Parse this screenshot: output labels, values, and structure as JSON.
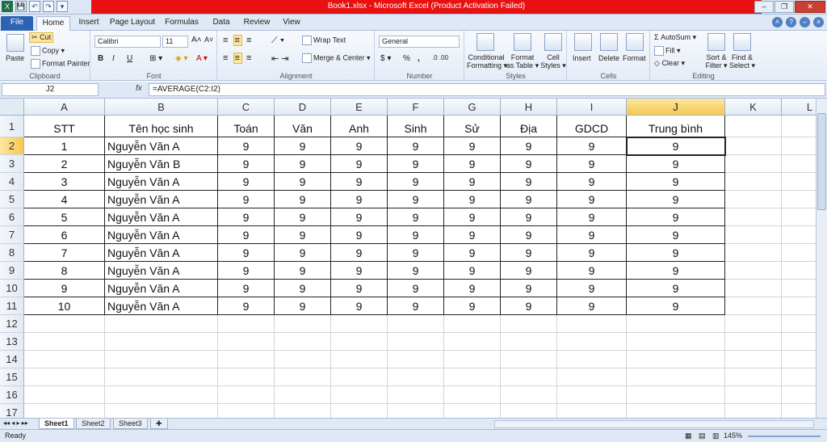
{
  "window": {
    "title": "Book1.xlsx - Microsoft Excel (Product Activation Failed)"
  },
  "qat": [
    "X",
    "💾",
    "↶",
    "↷",
    "▾"
  ],
  "tabs": [
    "File",
    "Home",
    "Insert",
    "Page Layout",
    "Formulas",
    "Data",
    "Review",
    "View"
  ],
  "ribbon": {
    "clipboard": {
      "paste": "Paste",
      "cut": "Cut",
      "copy": "Copy ▾",
      "painter": "Format Painter",
      "label": "Clipboard"
    },
    "font": {
      "name": "Calibri",
      "size": "11",
      "grow": "A˄",
      "shrink": "A˅",
      "bold": "B",
      "italic": "I",
      "underline": "U",
      "label": "Font"
    },
    "alignment": {
      "wrap": "Wrap Text",
      "merge": "Merge & Center ▾",
      "label": "Alignment"
    },
    "number": {
      "format": "General",
      "percent": "%",
      "comma": ",",
      "label": "Number"
    },
    "styles": {
      "cond1": "Conditional",
      "cond2": "Formatting ▾",
      "table1": "Format",
      "table2": "as Table ▾",
      "cell1": "Cell",
      "cell2": "Styles ▾",
      "label": "Styles"
    },
    "cells": {
      "insert": "Insert",
      "delete": "Delete",
      "format": "Format",
      "label": "Cells"
    },
    "editing": {
      "autosum": "AutoSum ▾",
      "fill": "Fill ▾",
      "clear": "Clear ▾",
      "sort1": "Sort &",
      "sort2": "Filter ▾",
      "find1": "Find &",
      "find2": "Select ▾",
      "label": "Editing"
    }
  },
  "formula_bar": {
    "name_box": "J2",
    "fx": "fx",
    "formula": "=AVERAGE(C2:I2)"
  },
  "columns": [
    "A",
    "B",
    "C",
    "D",
    "E",
    "F",
    "G",
    "H",
    "I",
    "J",
    "K",
    "L"
  ],
  "header_row": [
    "STT",
    "Tên học sinh",
    "Toán",
    "Văn",
    "Anh",
    "Sinh",
    "Sử",
    "Địa",
    "GDCD",
    "Trung bình"
  ],
  "rows": [
    [
      "1",
      "Nguyễn Văn A",
      "9",
      "9",
      "9",
      "9",
      "9",
      "9",
      "9",
      "9"
    ],
    [
      "2",
      "Nguyễn Văn B",
      "9",
      "9",
      "9",
      "9",
      "9",
      "9",
      "9",
      "9"
    ],
    [
      "3",
      "Nguyễn Văn A",
      "9",
      "9",
      "9",
      "9",
      "9",
      "9",
      "9",
      "9"
    ],
    [
      "4",
      "Nguyễn Văn A",
      "9",
      "9",
      "9",
      "9",
      "9",
      "9",
      "9",
      "9"
    ],
    [
      "5",
      "Nguyễn Văn A",
      "9",
      "9",
      "9",
      "9",
      "9",
      "9",
      "9",
      "9"
    ],
    [
      "6",
      "Nguyễn Văn A",
      "9",
      "9",
      "9",
      "9",
      "9",
      "9",
      "9",
      "9"
    ],
    [
      "7",
      "Nguyễn Văn A",
      "9",
      "9",
      "9",
      "9",
      "9",
      "9",
      "9",
      "9"
    ],
    [
      "8",
      "Nguyễn Văn A",
      "9",
      "9",
      "9",
      "9",
      "9",
      "9",
      "9",
      "9"
    ],
    [
      "9",
      "Nguyễn Văn A",
      "9",
      "9",
      "9",
      "9",
      "9",
      "9",
      "9",
      "9"
    ],
    [
      "10",
      "Nguyễn Văn A",
      "9",
      "9",
      "9",
      "9",
      "9",
      "9",
      "9",
      "9"
    ]
  ],
  "row_numbers": [
    "1",
    "2",
    "3",
    "4",
    "5",
    "6",
    "7",
    "8",
    "9",
    "10",
    "11",
    "12",
    "13",
    "14",
    "15",
    "16",
    "17"
  ],
  "sheets": [
    "Sheet1",
    "Sheet2",
    "Sheet3"
  ],
  "status": {
    "ready": "Ready",
    "zoom": "145%"
  }
}
